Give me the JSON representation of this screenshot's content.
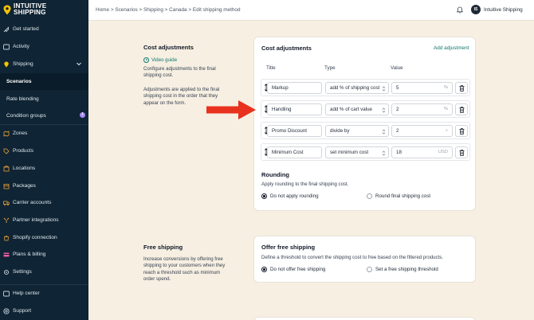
{
  "brand": {
    "name_line1": "INTUITIVE",
    "name_line2": "SHIPPING"
  },
  "sidebar": {
    "items": [
      {
        "label": "Get started",
        "icon": "rocket-icon"
      },
      {
        "label": "Activity",
        "icon": "activity-icon"
      },
      {
        "label": "Shipping",
        "icon": "shipping-icon"
      },
      {
        "label": "Scenarios"
      },
      {
        "label": "Rate blending"
      },
      {
        "label": "Condition groups",
        "badge": "i"
      },
      {
        "label": "Zones",
        "icon": "zones-icon"
      },
      {
        "label": "Products",
        "icon": "products-icon"
      },
      {
        "label": "Locations",
        "icon": "locations-icon"
      },
      {
        "label": "Packages",
        "icon": "packages-icon"
      },
      {
        "label": "Carrier accounts",
        "icon": "carrier-icon"
      },
      {
        "label": "Partner integrations",
        "icon": "integrations-icon"
      },
      {
        "label": "Shopify connection",
        "icon": "shopify-icon"
      },
      {
        "label": "Plans & billing",
        "icon": "billing-icon"
      },
      {
        "label": "Settings",
        "icon": "settings-icon"
      },
      {
        "label": "Help center",
        "icon": "help-icon"
      },
      {
        "label": "Support",
        "icon": "support-icon"
      }
    ]
  },
  "topbar": {
    "breadcrumb": "Home > Scenarios > Shipping > Canada > Edit shipping method",
    "avatar_initials": "IS",
    "company": "Intuitive Shipping"
  },
  "cost_adjustments": {
    "section_title": "Cost adjustments",
    "video_link": "Video guide",
    "desc1": "Configure adjustments to the final shipping cost.",
    "desc2": "Adjustments are applied to the final shipping cost in the order that they appear on the form.",
    "card_title": "Cost adjustments",
    "add_label": "Add adjustment",
    "col_title": "Title",
    "col_type": "Type",
    "col_value": "Value",
    "rows": [
      {
        "title": "Markup",
        "type": "add % of shipping cost",
        "value": "5",
        "unit": "%"
      },
      {
        "title": "Handling",
        "type": "add % of cart value",
        "value": "2",
        "unit": "%"
      },
      {
        "title": "Promo Discount",
        "type": "divide by",
        "value": "2",
        "unit": "÷"
      },
      {
        "title": "Minimum Cost",
        "type": "set minimum cost",
        "value": "18",
        "unit": "USD"
      }
    ],
    "rounding_title": "Rounding",
    "rounding_desc": "Apply rounding to the final shipping cost.",
    "rounding_opt1": "Do not apply rounding",
    "rounding_opt2": "Round final shipping cost"
  },
  "free_shipping": {
    "section_title": "Free shipping",
    "desc": "Increase conversions by offering free shipping to your customers when they reach a threshold such as minimum order spend.",
    "card_title": "Offer free shipping",
    "card_desc": "Define a threshold to convert the shipping cost to free based on the filtered products.",
    "opt1": "Do not offer free shipping",
    "opt2": "Set a free shipping threshold"
  },
  "colors": {
    "sidebar_bg": "#0f2434",
    "page_bg": "#f6efe2",
    "accent": "#0f766e",
    "annotation_arrow": "#e8321e"
  }
}
